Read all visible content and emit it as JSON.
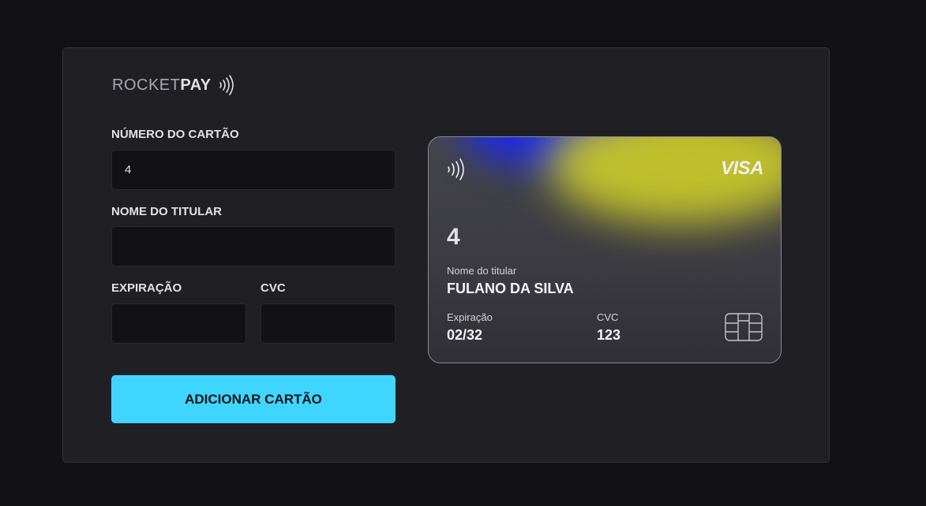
{
  "brand": {
    "light": "ROCKET",
    "bold": "PAY",
    "icon": "contactless-icon"
  },
  "form": {
    "card_number": {
      "label": "NÚMERO DO CARTÃO",
      "value": "4"
    },
    "holder_name": {
      "label": "NOME DO TITULAR",
      "value": ""
    },
    "expiration": {
      "label": "EXPIRAÇÃO",
      "value": ""
    },
    "cvc": {
      "label": "CVC",
      "value": ""
    },
    "submit_label": "ADICIONAR CARTÃO"
  },
  "card_preview": {
    "brand": "VISA",
    "number": "4",
    "holder_label": "Nome do titular",
    "holder_value": "FULANO DA SILVA",
    "expiration_label": "Expiração",
    "expiration_value": "02/32",
    "cvc_label": "CVC",
    "cvc_value": "123",
    "nfc_icon": "contactless-icon",
    "chip_icon": "chip-icon"
  },
  "colors": {
    "accent": "#3fd5ff",
    "panel": "#202024",
    "background": "#121214",
    "card_blue": "#1f2be0",
    "card_yellow": "#c8c62a"
  }
}
